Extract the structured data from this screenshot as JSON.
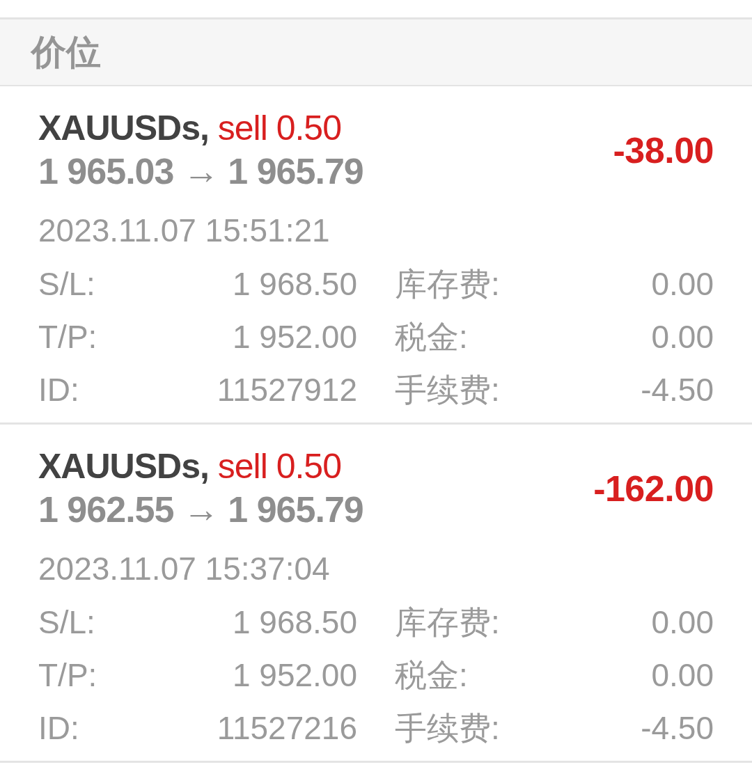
{
  "header": {
    "title": "价位"
  },
  "positions": [
    {
      "symbol": "XAUUSDs,",
      "order": "sell 0.50",
      "prices": "1 965.03 → 1 965.79",
      "profit": "-38.00",
      "loss": true,
      "time": "2023.11.07 15:51:21",
      "details": [
        {
          "label": "S/L:",
          "value": "1 968.50"
        },
        {
          "label": "库存费:",
          "value": "0.00"
        },
        {
          "label": "T/P:",
          "value": "1 952.00"
        },
        {
          "label": "税金:",
          "value": "0.00"
        },
        {
          "label": "ID:",
          "value": "11527912"
        },
        {
          "label": "手续费:",
          "value": "-4.50"
        }
      ]
    },
    {
      "symbol": "XAUUSDs,",
      "order": "sell 0.50",
      "prices": "1 962.55 → 1 965.79",
      "profit": "-162.00",
      "loss": true,
      "time": "2023.11.07 15:37:04",
      "details": [
        {
          "label": "S/L:",
          "value": "1 968.50"
        },
        {
          "label": "库存费:",
          "value": "0.00"
        },
        {
          "label": "T/P:",
          "value": "1 952.00"
        },
        {
          "label": "税金:",
          "value": "0.00"
        },
        {
          "label": "ID:",
          "value": "11527216"
        },
        {
          "label": "手续费:",
          "value": "-4.50"
        }
      ]
    }
  ]
}
